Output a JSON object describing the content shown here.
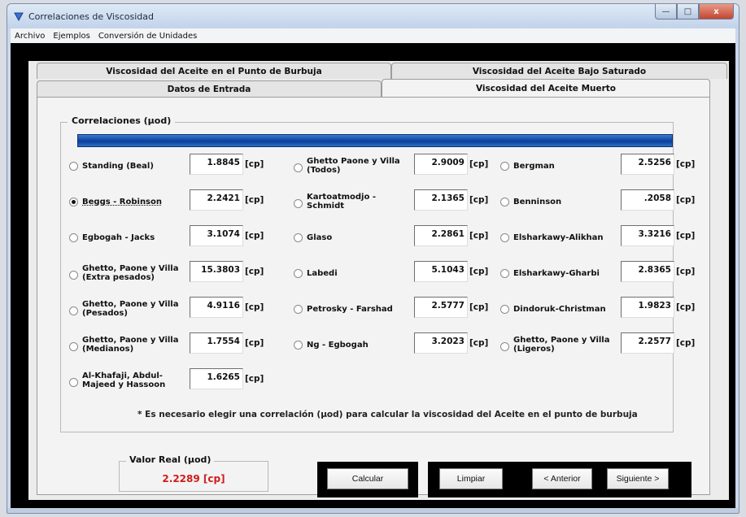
{
  "window": {
    "title": "Correlaciones de Viscosidad",
    "minimize": "—",
    "maximize": "□",
    "close": "x"
  },
  "menu": [
    "Archivo",
    "Ejemplos",
    "Conversión de Unidades"
  ],
  "tabs": {
    "row_back": [
      "Viscosidad del Aceite en el Punto de Burbuja",
      "Viscosidad del Aceite Bajo Saturado"
    ],
    "row_front": [
      "Datos de Entrada",
      "Viscosidad del Aceite Muerto"
    ],
    "active": "Viscosidad del Aceite Muerto"
  },
  "group_label": "Correlaciones (µod)",
  "unit": "[cp]",
  "correlations": [
    {
      "label": "Standing (Beal)",
      "value": "1.8845",
      "selected": false
    },
    {
      "label": "Ghetto Paone y Villa (Todos)",
      "value": "2.9009",
      "selected": false
    },
    {
      "label": "Bergman",
      "value": "2.5256",
      "selected": false
    },
    {
      "label": "Beggs - Robinson",
      "value": "2.2421",
      "selected": true
    },
    {
      "label": "Kartoatmodjo - Schmidt",
      "value": "2.1365",
      "selected": false
    },
    {
      "label": "Benninson",
      "value": ".2058",
      "selected": false
    },
    {
      "label": "Egbogah - Jacks",
      "value": "3.1074",
      "selected": false
    },
    {
      "label": "Glaso",
      "value": "2.2861",
      "selected": false
    },
    {
      "label": "Elsharkawy-Alikhan",
      "value": "3.3216",
      "selected": false
    },
    {
      "label": "Ghetto, Paone y Villa (Extra pesados)",
      "value": "15.3803",
      "selected": false
    },
    {
      "label": "Labedi",
      "value": "5.1043",
      "selected": false
    },
    {
      "label": "Elsharkawy-Gharbi",
      "value": "2.8365",
      "selected": false
    },
    {
      "label": "Ghetto, Paone y Villa (Pesados)",
      "value": "4.9116",
      "selected": false
    },
    {
      "label": "Petrosky - Farshad",
      "value": "2.5777",
      "selected": false
    },
    {
      "label": "Dindoruk-Christman",
      "value": "1.9823",
      "selected": false
    },
    {
      "label": "Ghetto, Paone y Villa (Medianos)",
      "value": "1.7554",
      "selected": false
    },
    {
      "label": "Ng - Egbogah",
      "value": "3.2023",
      "selected": false
    },
    {
      "label": "Ghetto, Paone y Villa (Ligeros)",
      "value": "2.2577",
      "selected": false
    },
    {
      "label": "Al-Khafaji, Abdul-Majeed y Hassoon",
      "value": "1.6265",
      "selected": false
    }
  ],
  "note": "* Es necesario elegir una correlación (µod) para calcular la viscosidad del Aceite en el punto de burbuja",
  "real": {
    "label": "Valor Real (µod)",
    "value": "2.2289 [cp]"
  },
  "buttons": {
    "calcular": "Calcular",
    "limpiar": "Limpiar",
    "anterior": "< Anterior",
    "siguiente": "Siguiente >"
  },
  "colors": {
    "accent_bar": "#0a3f9a",
    "real_value": "#d01c1c"
  }
}
